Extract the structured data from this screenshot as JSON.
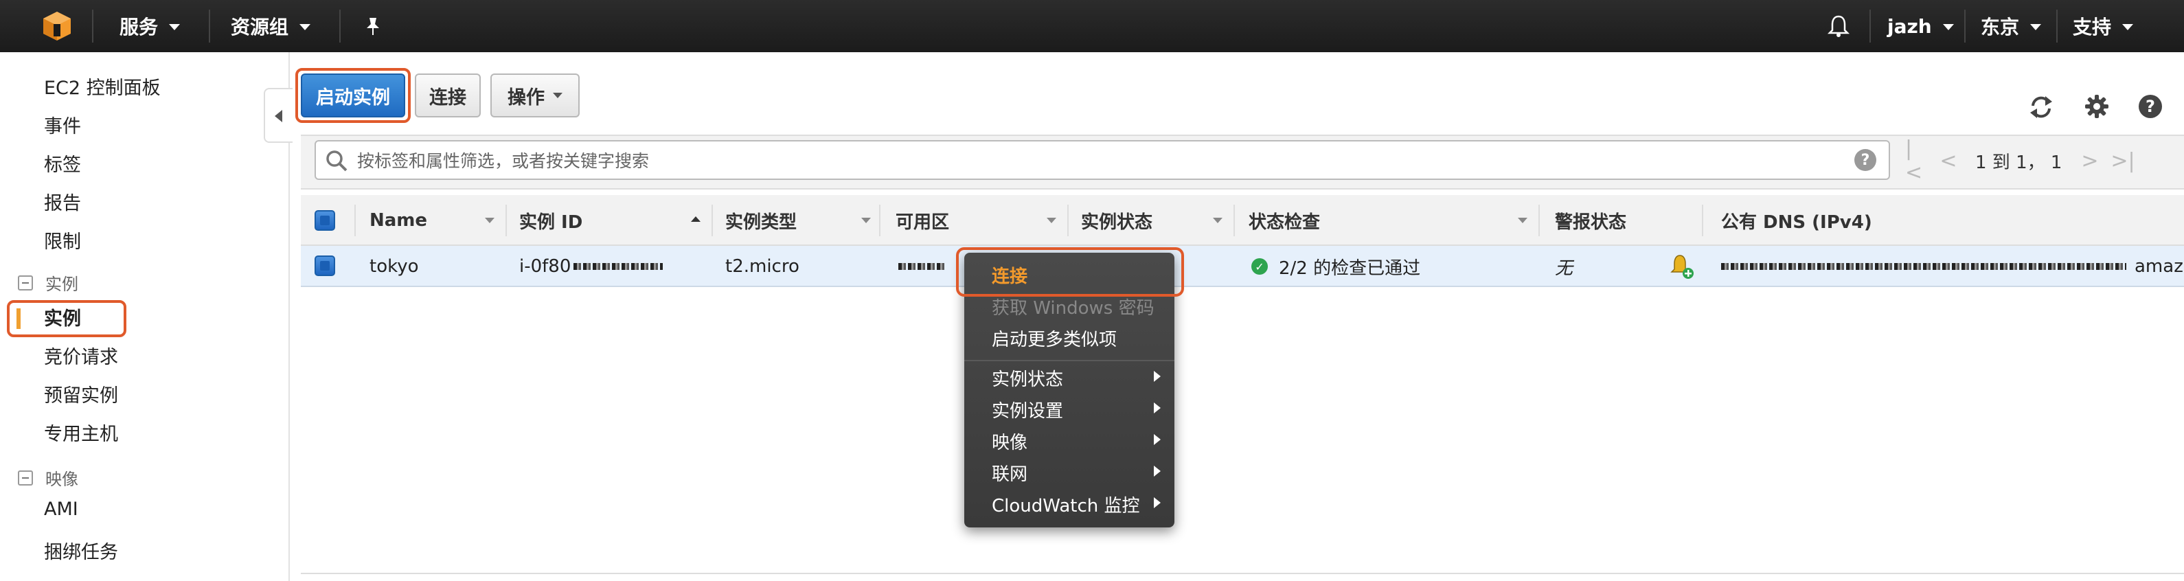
{
  "topbar": {
    "services": "服务",
    "resource_groups": "资源组",
    "account": "jazh",
    "region": "东京",
    "support": "支持"
  },
  "sidebar": {
    "items": [
      "EC2 控制面板",
      "事件",
      "标签",
      "报告",
      "限制"
    ],
    "group_instances": "实例",
    "instances_items": [
      "实例",
      "竞价请求",
      "预留实例",
      "专用主机"
    ],
    "group_images": "映像",
    "images_items": [
      "AMI",
      "捆绑任务"
    ]
  },
  "toolbar": {
    "launch_label": "启动实例",
    "connect_label": "连接",
    "actions_label": "操作"
  },
  "filter": {
    "placeholder": "按标签和属性筛选，或者按关键字搜索",
    "help": "?",
    "page_info": "1 到 1，  1"
  },
  "table": {
    "columns": [
      "Name",
      "实例 ID",
      "实例类型",
      "可用区",
      "实例状态",
      "状态检查",
      "警报状态",
      "公有 DNS (IPv4)"
    ],
    "rows": [
      {
        "name": "tokyo",
        "instance_id": "i-0f80",
        "instance_type": "t2.micro",
        "status_check": "2/2 的检查已通过",
        "alarm_status": "无",
        "dns_suffix": "amazonaws"
      }
    ]
  },
  "context_menu": {
    "items": [
      {
        "label": "连接",
        "state": "selected",
        "submenu": false
      },
      {
        "label": "获取 Windows 密码",
        "state": "disabled",
        "submenu": false
      },
      {
        "label": "启动更多类似项",
        "state": "normal",
        "submenu": false
      },
      {
        "label": "实例状态",
        "state": "normal",
        "submenu": true
      },
      {
        "label": "实例设置",
        "state": "normal",
        "submenu": true
      },
      {
        "label": "映像",
        "state": "normal",
        "submenu": true
      },
      {
        "label": "联网",
        "state": "normal",
        "submenu": true
      },
      {
        "label": "CloudWatch 监控",
        "state": "normal",
        "submenu": true
      }
    ]
  },
  "colors": {
    "topbar": "#232323",
    "primary_button": "#2a7cd3",
    "highlight_outline": "#e05a2b",
    "menu_selected": "#f39a2c",
    "row_selected": "#e6f0fb"
  }
}
